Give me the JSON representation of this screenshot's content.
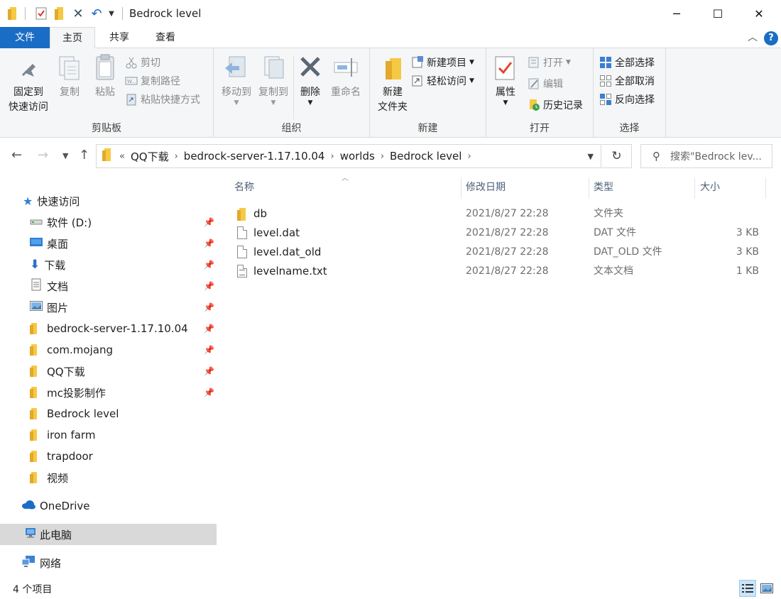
{
  "window": {
    "title": "Bedrock level",
    "minimize": "─",
    "maximize": "☐",
    "close": "✕"
  },
  "tabs": {
    "file": "文件",
    "home": "主页",
    "share": "共享",
    "view": "查看",
    "help": "?"
  },
  "ribbon": {
    "clipboard": {
      "label": "剪贴板",
      "pin_line1": "固定到",
      "pin_line2": "快速访问",
      "copy": "复制",
      "paste": "粘贴",
      "cut": "剪切",
      "copy_path": "复制路径",
      "paste_shortcut": "粘贴快捷方式"
    },
    "organize": {
      "label": "组织",
      "move_to": "移动到",
      "copy_to": "复制到",
      "delete": "删除",
      "rename": "重命名"
    },
    "new": {
      "label": "新建",
      "new_folder_line1": "新建",
      "new_folder_line2": "文件夹",
      "new_item": "新建项目",
      "easy_access": "轻松访问"
    },
    "open": {
      "label": "打开",
      "properties": "属性",
      "open": "打开",
      "edit": "编辑",
      "history": "历史记录"
    },
    "select": {
      "label": "选择",
      "select_all": "全部选择",
      "select_none": "全部取消",
      "invert": "反向选择"
    }
  },
  "address": {
    "prefix": "«",
    "crumbs": [
      "QQ下载",
      "bedrock-server-1.17.10.04",
      "worlds",
      "Bedrock level"
    ],
    "search_placeholder": "搜索\"Bedrock lev..."
  },
  "nav": {
    "quick_access": "快速访问",
    "items": [
      {
        "label": "软件 (D:)",
        "pinned": true
      },
      {
        "label": "桌面",
        "pinned": true
      },
      {
        "label": "下载",
        "pinned": true
      },
      {
        "label": "文档",
        "pinned": true
      },
      {
        "label": "图片",
        "pinned": true
      },
      {
        "label": "bedrock-server-1.17.10.04",
        "pinned": true
      },
      {
        "label": "com.mojang",
        "pinned": true
      },
      {
        "label": "QQ下载",
        "pinned": true
      },
      {
        "label": "mc投影制作",
        "pinned": true
      },
      {
        "label": "Bedrock level",
        "pinned": false
      },
      {
        "label": "iron farm",
        "pinned": false
      },
      {
        "label": "trapdoor",
        "pinned": false
      },
      {
        "label": "视频",
        "pinned": false
      }
    ],
    "onedrive": "OneDrive",
    "this_pc": "此电脑",
    "network": "网络"
  },
  "columns": {
    "name": "名称",
    "modified": "修改日期",
    "type": "类型",
    "size": "大小"
  },
  "files": [
    {
      "name": "db",
      "modified": "2021/8/27 22:28",
      "type": "文件夹",
      "size": "",
      "kind": "folder"
    },
    {
      "name": "level.dat",
      "modified": "2021/8/27 22:28",
      "type": "DAT 文件",
      "size": "3 KB",
      "kind": "file"
    },
    {
      "name": "level.dat_old",
      "modified": "2021/8/27 22:28",
      "type": "DAT_OLD 文件",
      "size": "3 KB",
      "kind": "file"
    },
    {
      "name": "levelname.txt",
      "modified": "2021/8/27 22:28",
      "type": "文本文档",
      "size": "1 KB",
      "kind": "text"
    }
  ],
  "status": {
    "count": "4 个项目"
  },
  "colors": {
    "accent": "#1a6dc4",
    "folder": "#f6c944",
    "selection": "#d9d9d9"
  }
}
